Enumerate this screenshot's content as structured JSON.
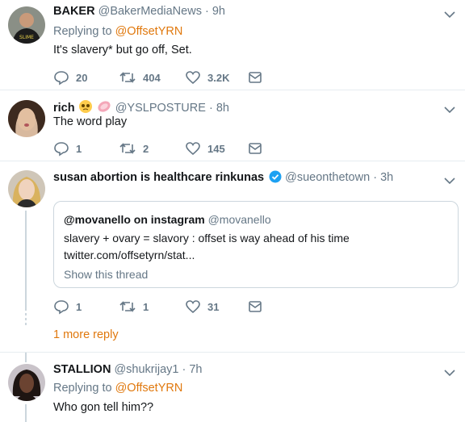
{
  "tweets": [
    {
      "name": "BAKER",
      "handle": "@BakerMediaNews",
      "time": "9h",
      "replying_prefix": "Replying to",
      "replying_to": "@OffsetYRN",
      "text": "It's slavery* but go off, Set.",
      "replies": "20",
      "retweets": "404",
      "likes": "3.2K"
    },
    {
      "name": "rich",
      "handle": "@YSLPOSTURE",
      "time": "8h",
      "text": "The word play",
      "replies": "1",
      "retweets": "2",
      "likes": "145"
    },
    {
      "name": "susan abortion is healthcare rinkunas",
      "handle": "@sueonthetown",
      "time": "3h",
      "quote": {
        "name": "@movanello on instagram",
        "handle": "@movanello",
        "text": "slavery + ovary = slavory : offset is way ahead of his time",
        "link": "twitter.com/offsetyrn/stat...",
        "show_thread": "Show this thread"
      },
      "replies": "1",
      "retweets": "1",
      "likes": "31"
    },
    {
      "name": "STALLION",
      "handle": "@shukrijay1",
      "time": "7h",
      "replying_prefix": "Replying to",
      "replying_to": "@OffsetYRN",
      "text": "Who gon tell him??"
    }
  ],
  "more_replies": "1 more reply",
  "dot": "·",
  "colors": {
    "accent": "#e0780d",
    "muted": "#657786",
    "divider": "#e6ecf0",
    "verified": "#1da1f2"
  },
  "icons": [
    "reply-icon",
    "retweet-icon",
    "like-icon",
    "dm-icon",
    "chevron-down-icon",
    "verified-icon"
  ]
}
